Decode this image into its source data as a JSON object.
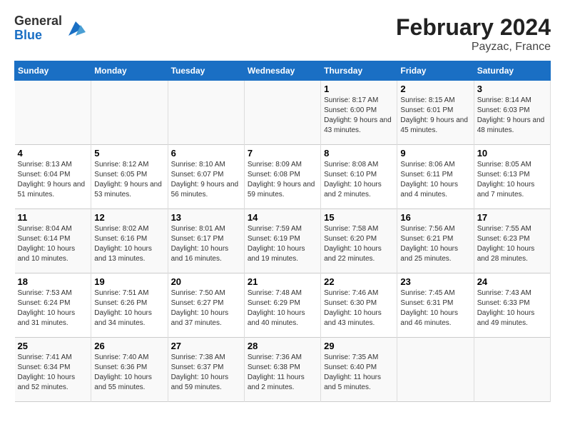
{
  "logo": {
    "general": "General",
    "blue": "Blue"
  },
  "title": "February 2024",
  "subtitle": "Payzac, France",
  "days_of_week": [
    "Sunday",
    "Monday",
    "Tuesday",
    "Wednesday",
    "Thursday",
    "Friday",
    "Saturday"
  ],
  "weeks": [
    [
      {
        "day": "",
        "info": ""
      },
      {
        "day": "",
        "info": ""
      },
      {
        "day": "",
        "info": ""
      },
      {
        "day": "",
        "info": ""
      },
      {
        "day": "1",
        "info": "Sunrise: 8:17 AM\nSunset: 6:00 PM\nDaylight: 9 hours and 43 minutes."
      },
      {
        "day": "2",
        "info": "Sunrise: 8:15 AM\nSunset: 6:01 PM\nDaylight: 9 hours and 45 minutes."
      },
      {
        "day": "3",
        "info": "Sunrise: 8:14 AM\nSunset: 6:03 PM\nDaylight: 9 hours and 48 minutes."
      }
    ],
    [
      {
        "day": "4",
        "info": "Sunrise: 8:13 AM\nSunset: 6:04 PM\nDaylight: 9 hours and 51 minutes."
      },
      {
        "day": "5",
        "info": "Sunrise: 8:12 AM\nSunset: 6:05 PM\nDaylight: 9 hours and 53 minutes."
      },
      {
        "day": "6",
        "info": "Sunrise: 8:10 AM\nSunset: 6:07 PM\nDaylight: 9 hours and 56 minutes."
      },
      {
        "day": "7",
        "info": "Sunrise: 8:09 AM\nSunset: 6:08 PM\nDaylight: 9 hours and 59 minutes."
      },
      {
        "day": "8",
        "info": "Sunrise: 8:08 AM\nSunset: 6:10 PM\nDaylight: 10 hours and 2 minutes."
      },
      {
        "day": "9",
        "info": "Sunrise: 8:06 AM\nSunset: 6:11 PM\nDaylight: 10 hours and 4 minutes."
      },
      {
        "day": "10",
        "info": "Sunrise: 8:05 AM\nSunset: 6:13 PM\nDaylight: 10 hours and 7 minutes."
      }
    ],
    [
      {
        "day": "11",
        "info": "Sunrise: 8:04 AM\nSunset: 6:14 PM\nDaylight: 10 hours and 10 minutes."
      },
      {
        "day": "12",
        "info": "Sunrise: 8:02 AM\nSunset: 6:16 PM\nDaylight: 10 hours and 13 minutes."
      },
      {
        "day": "13",
        "info": "Sunrise: 8:01 AM\nSunset: 6:17 PM\nDaylight: 10 hours and 16 minutes."
      },
      {
        "day": "14",
        "info": "Sunrise: 7:59 AM\nSunset: 6:19 PM\nDaylight: 10 hours and 19 minutes."
      },
      {
        "day": "15",
        "info": "Sunrise: 7:58 AM\nSunset: 6:20 PM\nDaylight: 10 hours and 22 minutes."
      },
      {
        "day": "16",
        "info": "Sunrise: 7:56 AM\nSunset: 6:21 PM\nDaylight: 10 hours and 25 minutes."
      },
      {
        "day": "17",
        "info": "Sunrise: 7:55 AM\nSunset: 6:23 PM\nDaylight: 10 hours and 28 minutes."
      }
    ],
    [
      {
        "day": "18",
        "info": "Sunrise: 7:53 AM\nSunset: 6:24 PM\nDaylight: 10 hours and 31 minutes."
      },
      {
        "day": "19",
        "info": "Sunrise: 7:51 AM\nSunset: 6:26 PM\nDaylight: 10 hours and 34 minutes."
      },
      {
        "day": "20",
        "info": "Sunrise: 7:50 AM\nSunset: 6:27 PM\nDaylight: 10 hours and 37 minutes."
      },
      {
        "day": "21",
        "info": "Sunrise: 7:48 AM\nSunset: 6:29 PM\nDaylight: 10 hours and 40 minutes."
      },
      {
        "day": "22",
        "info": "Sunrise: 7:46 AM\nSunset: 6:30 PM\nDaylight: 10 hours and 43 minutes."
      },
      {
        "day": "23",
        "info": "Sunrise: 7:45 AM\nSunset: 6:31 PM\nDaylight: 10 hours and 46 minutes."
      },
      {
        "day": "24",
        "info": "Sunrise: 7:43 AM\nSunset: 6:33 PM\nDaylight: 10 hours and 49 minutes."
      }
    ],
    [
      {
        "day": "25",
        "info": "Sunrise: 7:41 AM\nSunset: 6:34 PM\nDaylight: 10 hours and 52 minutes."
      },
      {
        "day": "26",
        "info": "Sunrise: 7:40 AM\nSunset: 6:36 PM\nDaylight: 10 hours and 55 minutes."
      },
      {
        "day": "27",
        "info": "Sunrise: 7:38 AM\nSunset: 6:37 PM\nDaylight: 10 hours and 59 minutes."
      },
      {
        "day": "28",
        "info": "Sunrise: 7:36 AM\nSunset: 6:38 PM\nDaylight: 11 hours and 2 minutes."
      },
      {
        "day": "29",
        "info": "Sunrise: 7:35 AM\nSunset: 6:40 PM\nDaylight: 11 hours and 5 minutes."
      },
      {
        "day": "",
        "info": ""
      },
      {
        "day": "",
        "info": ""
      }
    ]
  ]
}
